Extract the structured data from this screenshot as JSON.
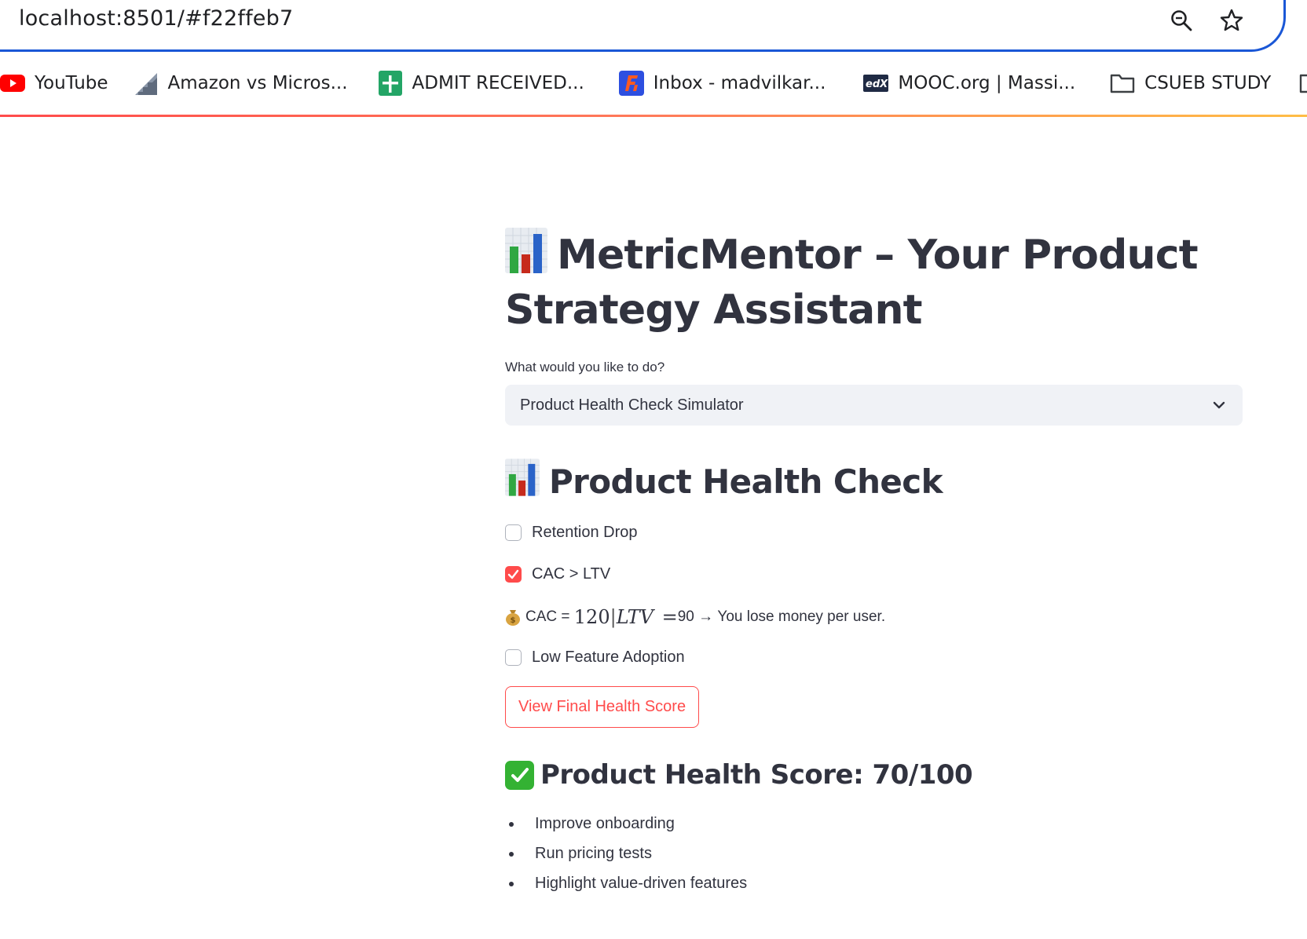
{
  "browser": {
    "url": "localhost:8501/#f22ffeb7",
    "bookmarks": [
      {
        "label": "YouTube",
        "icon": "youtube-icon"
      },
      {
        "label": "Amazon vs Micros...",
        "icon": "chart-stairs-icon"
      },
      {
        "label": "ADMIT RECEIVED...",
        "icon": "google-sheets-icon"
      },
      {
        "label": "Inbox - madvilkar...",
        "icon": "mail-app-icon"
      },
      {
        "label": "MOOC.org | Massi...",
        "icon": "edx-icon"
      },
      {
        "label": "CSUEB STUDY",
        "icon": "folder-icon"
      }
    ]
  },
  "app": {
    "title": "MetricMentor – Your Product Strategy Assistant",
    "select": {
      "label": "What would you like to do?",
      "value": "Product Health Check Simulator"
    },
    "section_title": "Product Health Check",
    "checks": [
      {
        "label": "Retention Drop",
        "checked": false
      },
      {
        "label": "CAC > LTV",
        "checked": true
      },
      {
        "label": "Low Feature Adoption",
        "checked": false
      }
    ],
    "cac_line": {
      "prefix": "CAC =",
      "cac_value": "120",
      "separator": "|",
      "ltv_symbol": "LTV",
      "equals": "=",
      "ltv_value": "90",
      "arrow": "→",
      "message": "You lose money per user."
    },
    "button_label": "View Final Health Score",
    "score_title": "Product Health Score: 70/100",
    "recommendations": [
      "Improve onboarding",
      "Run pricing tests",
      "Highlight value-driven features"
    ]
  },
  "colors": {
    "accent": "#ff4b4b",
    "text": "#31333f",
    "select_bg": "#f0f2f6",
    "omnibox_border": "#1a57d6"
  }
}
